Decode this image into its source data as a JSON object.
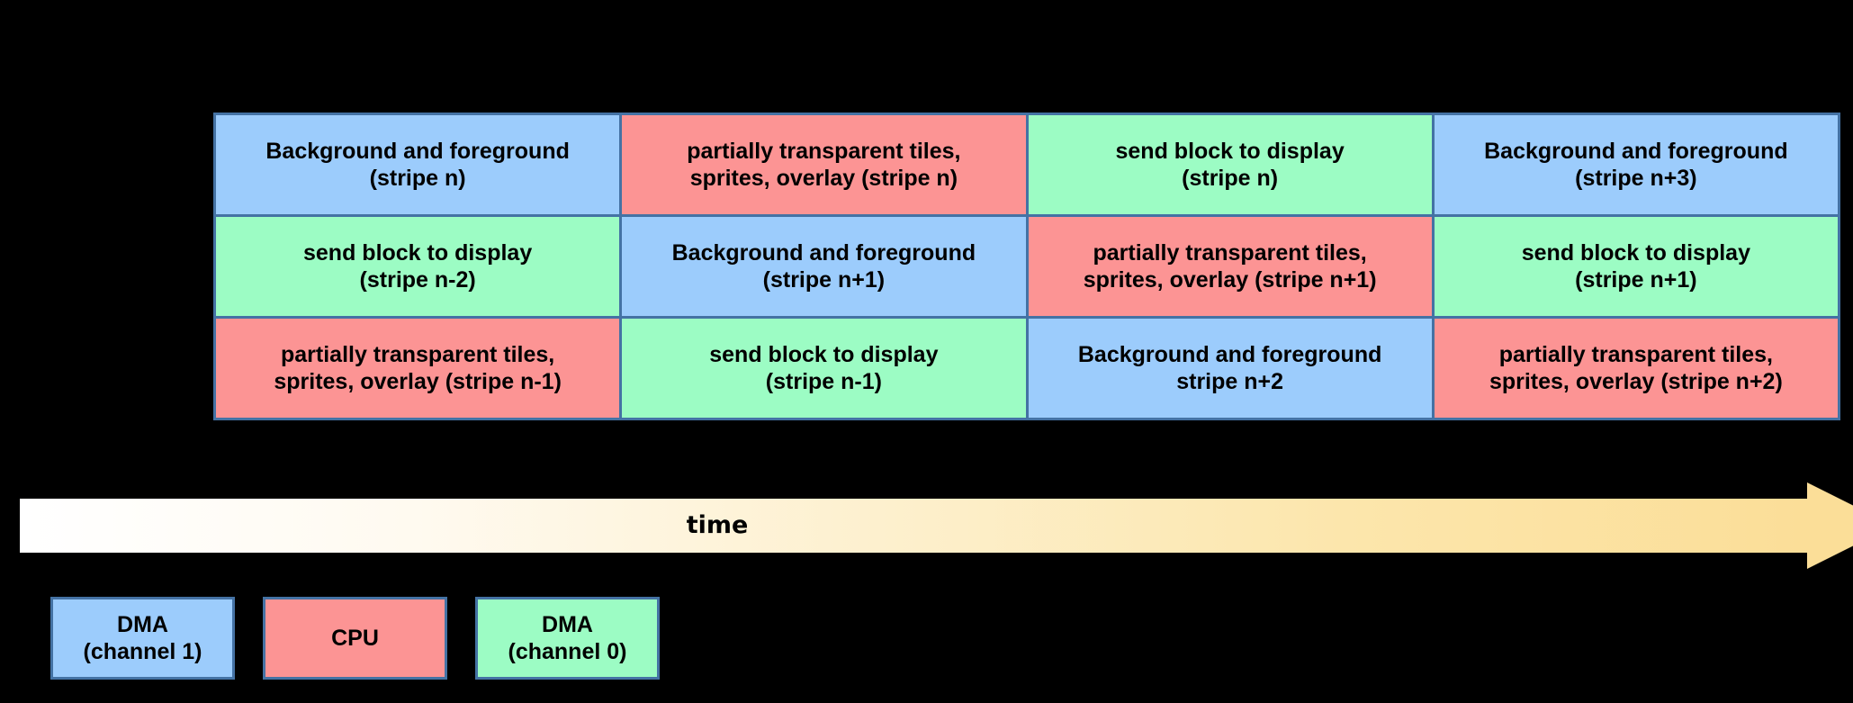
{
  "diagram": {
    "colors": {
      "dma_channel_1": "#9CCCFC",
      "cpu": "#FC9494",
      "dma_channel_0": "#9CFCC4",
      "cell_border": "#4472A4",
      "arrow_start": "#FFFFFF",
      "arrow_end": "#FBDE98",
      "background": "#000000",
      "text": "#000000"
    },
    "table": {
      "rows": [
        [
          {
            "color_role": "dma_channel_1",
            "line1": "Background and foreground",
            "line2": "(stripe n)"
          },
          {
            "color_role": "cpu",
            "line1": "partially transparent tiles,",
            "line2": "sprites, overlay (stripe n)"
          },
          {
            "color_role": "dma_channel_0",
            "line1": "send block to display",
            "line2": "(stripe n)"
          },
          {
            "color_role": "dma_channel_1",
            "line1": "Background and foreground",
            "line2": "(stripe n+3)"
          }
        ],
        [
          {
            "color_role": "dma_channel_0",
            "line1": "send block to display",
            "line2": "(stripe n-2)"
          },
          {
            "color_role": "dma_channel_1",
            "line1": "Background and foreground",
            "line2": "(stripe n+1)"
          },
          {
            "color_role": "cpu",
            "line1": "partially transparent tiles,",
            "line2": "sprites, overlay (stripe n+1)"
          },
          {
            "color_role": "dma_channel_0",
            "line1": "send block to display",
            "line2": "(stripe n+1)"
          }
        ],
        [
          {
            "color_role": "cpu",
            "line1": "partially transparent tiles,",
            "line2": "sprites, overlay (stripe n-1)"
          },
          {
            "color_role": "dma_channel_0",
            "line1": "send block to display",
            "line2": "(stripe n-1)"
          },
          {
            "color_role": "dma_channel_1",
            "line1": "Background and foreground",
            "line2": "stripe n+2"
          },
          {
            "color_role": "cpu",
            "line1": "partially transparent tiles,",
            "line2": "sprites, overlay (stripe n+2)"
          }
        ]
      ]
    },
    "time_axis": {
      "label": "time",
      "direction": "left-to-right"
    },
    "legend": {
      "items": [
        {
          "color_role": "dma_channel_1",
          "line1": "DMA",
          "line2": "(channel 1)"
        },
        {
          "color_role": "cpu",
          "line1": "CPU",
          "line2": ""
        },
        {
          "color_role": "dma_channel_0",
          "line1": "DMA",
          "line2": "(channel 0)"
        }
      ]
    }
  }
}
